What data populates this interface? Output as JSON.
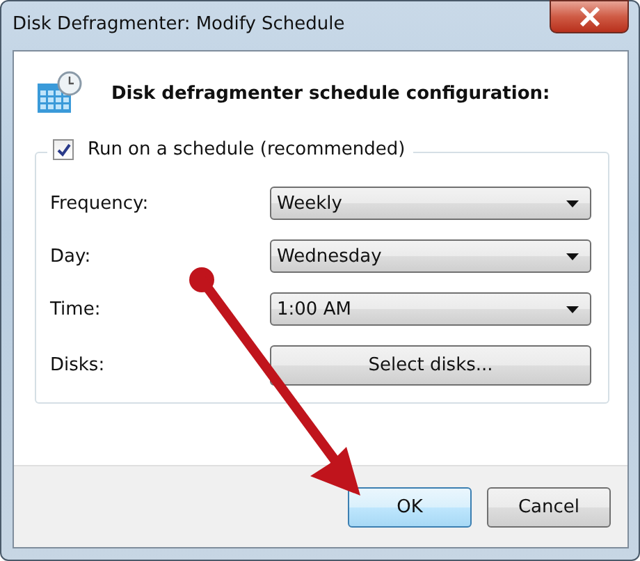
{
  "window": {
    "title": "Disk Defragmenter: Modify Schedule"
  },
  "heading": "Disk defragmenter schedule configuration:",
  "schedule": {
    "label": "Run on a schedule (recommended)",
    "checked": true
  },
  "fields": [
    {
      "kind": "dropdown",
      "label": "Frequency:",
      "value": "Weekly"
    },
    {
      "kind": "dropdown",
      "label": "Day:",
      "value": "Wednesday"
    },
    {
      "kind": "dropdown",
      "label": "Time:",
      "value": "1:00 AM"
    },
    {
      "kind": "button",
      "label": "Disks:",
      "value": "Select disks..."
    }
  ],
  "buttons": [
    {
      "label": "OK",
      "default": true
    },
    {
      "label": "Cancel",
      "default": false
    }
  ]
}
